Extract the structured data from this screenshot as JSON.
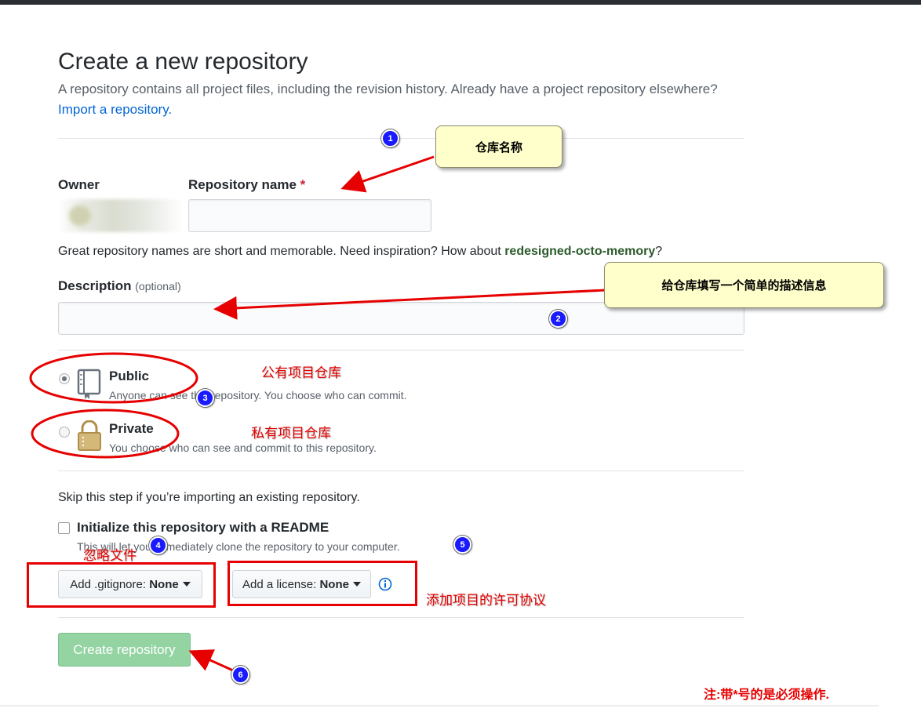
{
  "header": {
    "title": "Create a new repository",
    "subtitle": "A repository contains all project files, including the revision history. Already have a project repository elsewhere?",
    "import_link": "Import a repository."
  },
  "form": {
    "owner_label": "Owner",
    "repo_name_label": "Repository name",
    "required_mark": "*",
    "repo_name_value": "",
    "name_hint_prefix": "Great repository names are short and memorable. Need inspiration? How about ",
    "name_suggestion": "redesigned-octo-memory",
    "name_hint_suffix": "?",
    "description_label": "Description",
    "description_optional": "(optional)",
    "description_value": ""
  },
  "visibility": {
    "selected": "Public",
    "public": {
      "title": "Public",
      "desc": "Anyone can see this repository. You choose who can commit."
    },
    "private": {
      "title": "Private",
      "desc": "You choose who can see and commit to this repository."
    }
  },
  "init": {
    "skip_text": "Skip this step if you’re importing an existing repository.",
    "readme_label": "Initialize this repository with a README",
    "readme_checked": false,
    "readme_desc": "This will let you immediately clone the repository to your computer.",
    "gitignore_prefix": "Add .gitignore:",
    "gitignore_value": "None",
    "license_prefix": "Add a license:",
    "license_value": "None",
    "info_icon": "info-icon"
  },
  "submit": {
    "create_label": "Create repository"
  },
  "annotations": {
    "callout_1": "仓库名称",
    "callout_2": "给仓库填写一个简单的描述信息",
    "label_public": "公有项目仓库",
    "label_private": "私有项目仓库",
    "label_gitignore": "忽略文件",
    "label_license": "添加项目的许可协议",
    "footnote": "注:带*号的是必须操作.",
    "badges": [
      "1",
      "2",
      "3",
      "4",
      "5",
      "6"
    ]
  },
  "colors": {
    "link": "#0366d6",
    "create_button_disabled": "#94d3a2",
    "annotation_red": "#e60000",
    "callout_bg": "#ffffcc",
    "badge_blue": "#1a1aff"
  }
}
